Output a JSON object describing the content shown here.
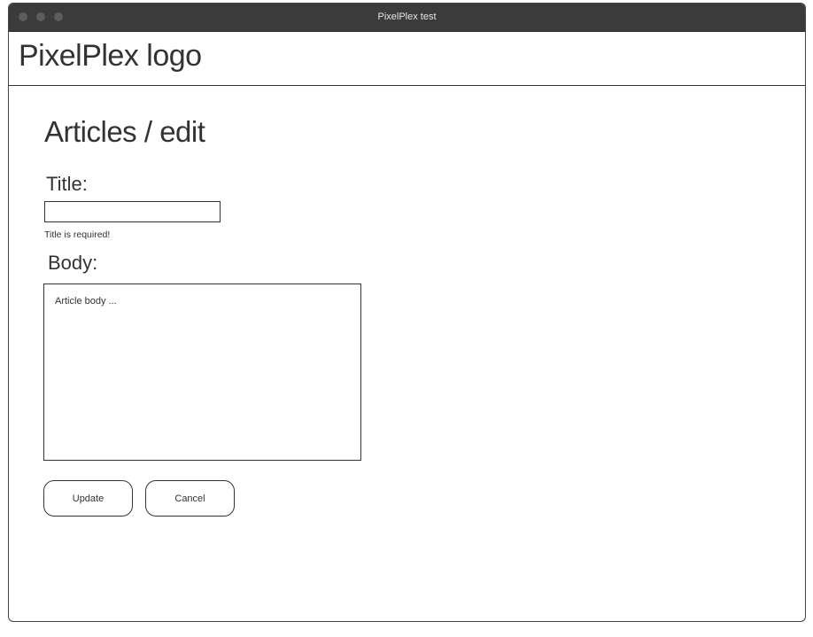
{
  "window": {
    "title": "PixelPlex test"
  },
  "header": {
    "logo_text": "PixelPlex logo"
  },
  "page": {
    "title": "Articles / edit"
  },
  "form": {
    "title_label": "Title:",
    "title_value": "",
    "title_error": "Title is required!",
    "body_label": "Body:",
    "body_placeholder": "Article body ...",
    "update_label": "Update",
    "cancel_label": "Cancel"
  },
  "colors": {
    "titlebar": "#3b3b3b",
    "text": "#333333",
    "border": "#333333"
  }
}
